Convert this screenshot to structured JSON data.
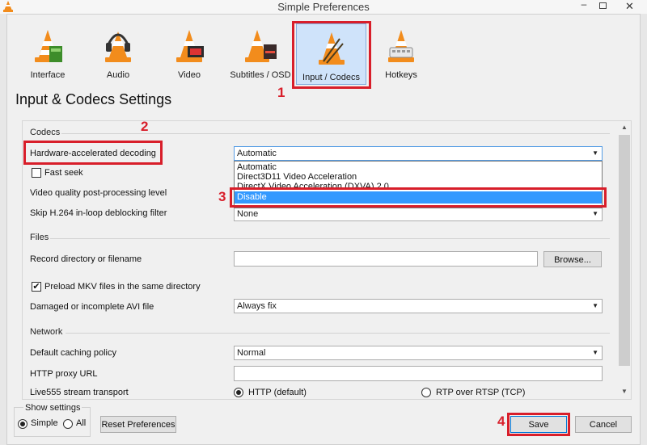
{
  "window": {
    "title": "Simple Preferences",
    "controls": {
      "minimize": "–",
      "maximize": "",
      "close": "✕"
    }
  },
  "categories": [
    {
      "label": "Interface",
      "icon": "cone-interface-icon"
    },
    {
      "label": "Audio",
      "icon": "cone-headphones-icon"
    },
    {
      "label": "Video",
      "icon": "cone-film-icon"
    },
    {
      "label": "Subtitles / OSD",
      "icon": "cone-subtitles-icon"
    },
    {
      "label": "Input / Codecs",
      "icon": "cone-codecs-icon",
      "active": true
    },
    {
      "label": "Hotkeys",
      "icon": "cone-hotkeys-icon"
    }
  ],
  "page_title": "Input & Codecs Settings",
  "codecs": {
    "section": "Codecs",
    "hw_decoding": {
      "label": "Hardware-accelerated decoding",
      "value": "Automatic"
    },
    "fast_seek": {
      "label": "Fast seek",
      "checked": false
    },
    "vq_postproc": {
      "label": "Video quality post-processing level"
    },
    "skip_h264": {
      "label": "Skip H.264 in-loop deblocking filter",
      "value": "None"
    },
    "dropdown_options": [
      "Automatic",
      "Direct3D11 Video Acceleration",
      "DirectX Video Acceleration (DXVA) 2.0",
      "Disable"
    ],
    "dropdown_selected": "Disable"
  },
  "files": {
    "section": "Files",
    "record_dir": {
      "label": "Record directory or filename",
      "value": "",
      "button": "Browse..."
    },
    "preload_mkv": {
      "label": "Preload MKV files in the same directory",
      "checked": true
    },
    "damaged_avi": {
      "label": "Damaged or incomplete AVI file",
      "value": "Always fix"
    }
  },
  "network": {
    "section": "Network",
    "caching": {
      "label": "Default caching policy",
      "value": "Normal"
    },
    "http_proxy": {
      "label": "HTTP proxy URL",
      "value": ""
    },
    "live555": {
      "label": "Live555 stream transport",
      "options": [
        "HTTP (default)",
        "RTP over RTSP (TCP)"
      ],
      "selected": "HTTP (default)"
    }
  },
  "bottom": {
    "show_settings_label": "Show settings",
    "show_settings_options": [
      "Simple",
      "All"
    ],
    "show_settings_selected": "Simple",
    "reset_button": "Reset Preferences",
    "save_button": "Save",
    "cancel_button": "Cancel"
  },
  "annotations": [
    "1",
    "2",
    "3",
    "4"
  ],
  "colors": {
    "annotation": "#d81e2a",
    "selection": "#3399ff",
    "active_tab": "#cfe3fa",
    "cone_orange": "#f28c1c"
  }
}
